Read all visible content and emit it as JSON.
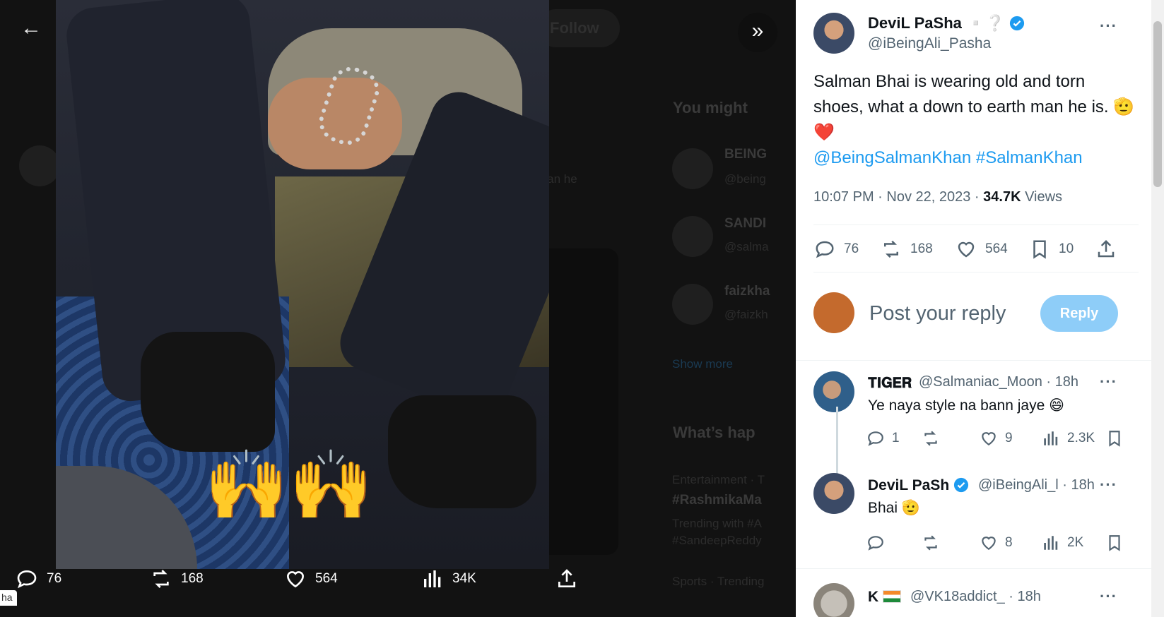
{
  "viewer": {
    "ghost_follow": "Follow",
    "ghost_you_might": "You might",
    "ghost_whats": "What’s hap",
    "ghost_show_more": "Show more",
    "ghost_trend1": "#RashmikaMa",
    "ghost_trend2": "#SandeepReddy",
    "ghost_tag": "Entertainment · T",
    "ghost_trending": "Trending with #A",
    "ghost_sports": "Sports · Trending",
    "ghost_acc1": "BEING",
    "ghost_acc2": "SANDI",
    "ghost_acc3": "faizkha",
    "ghost_handle1": "@being",
    "ghost_handle2": "@salma",
    "ghost_handle3": "@faizkh",
    "ghost_man_he": "man he",
    "emoji_overlay": "🙌",
    "actions": {
      "replies": "76",
      "reposts": "168",
      "likes": "564",
      "views": "34K"
    },
    "edge_tab": "ha"
  },
  "tweet": {
    "author_name": "DeviL PaSha",
    "author_suffix": "▫️❔",
    "author_handle": "@iBeingAli_Pasha",
    "text_line": "Salman Bhai is wearing old and torn shoes, what a down to earth man he is. 🫡❤️",
    "mention": "@BeingSalmanKhan",
    "hashtag": "#SalmanKhan",
    "time": "10:07 PM · Nov 22, 2023 · ",
    "views_count": "34.7K",
    "views_label": " Views",
    "stats": {
      "replies": "76",
      "reposts": "168",
      "likes": "564",
      "bookmarks": "10"
    }
  },
  "reply_box": {
    "placeholder": "Post your reply",
    "button": "Reply"
  },
  "comments": [
    {
      "name": "𝐓𝐈𝐆𝐄𝐑",
      "handle": "@Salmaniac_Moon",
      "time": "· 18h",
      "text": "Ye naya style na bann jaye 😄",
      "replies": "1",
      "reposts": "",
      "likes": "9",
      "views": "2.3K"
    },
    {
      "name": "DeviL PaSh",
      "handle": "@iBeingAli_l",
      "time": "· 18h",
      "text": "Bhai 🫡",
      "replies": "",
      "reposts": "",
      "likes": "8",
      "views": "2K"
    },
    {
      "name": "K",
      "handle": "@VK18addict_",
      "time": "· 18h",
      "text": "",
      "replies": "",
      "reposts": "",
      "likes": "",
      "views": ""
    }
  ],
  "colors": {
    "accent": "#1d9bf0",
    "reply_button": "#8ecdf8",
    "muted_text": "#536471"
  }
}
